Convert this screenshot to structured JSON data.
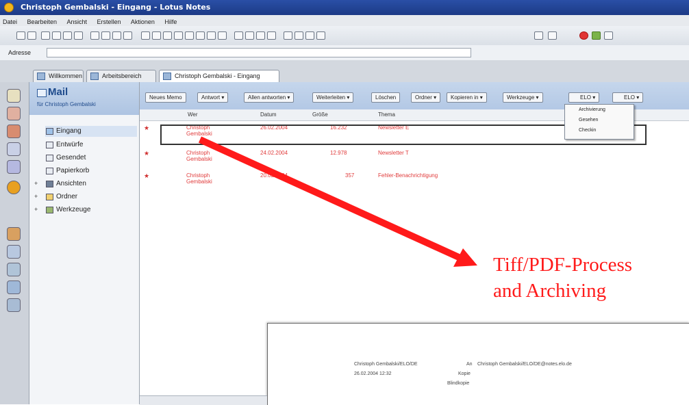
{
  "window": {
    "title": "Christoph Gembalski - Eingang - Lotus Notes"
  },
  "menu": [
    "Datei",
    "Bearbeiten",
    "Ansicht",
    "Erstellen",
    "Aktionen",
    "Hilfe"
  ],
  "address": {
    "label": "Adresse"
  },
  "tabs": [
    {
      "label": "Willkommen"
    },
    {
      "label": "Arbeitsbereich"
    },
    {
      "label": "Christoph Gembalski - Eingang"
    }
  ],
  "nav": {
    "title": "Mail",
    "subtitle": "für Christoph Gembalski",
    "items": [
      {
        "label": "Eingang"
      },
      {
        "label": "Entwürfe"
      },
      {
        "label": "Gesendet"
      },
      {
        "label": "Papierkorb"
      },
      {
        "label": "Ansichten"
      },
      {
        "label": "Ordner"
      },
      {
        "label": "Werkzeuge"
      }
    ]
  },
  "actions": [
    "Neues Memo",
    "Antwort ▾",
    "Allen antworten ▾",
    "Weiterleiten ▾",
    "Löschen",
    "Ordner ▾",
    "Kopieren in ▾",
    "Werkzeuge ▾",
    "ELO ▾",
    "ELO ▾"
  ],
  "dropdown": {
    "items": [
      "Archivierung",
      "Gesehen",
      "Checkin"
    ]
  },
  "columns": {
    "from": "Wer",
    "date": "Datum",
    "size": "Größe",
    "subject": "Thema"
  },
  "rows": [
    {
      "from": "Christoph Gembalski",
      "date": "26.02.2004",
      "size": "16.232",
      "subject": "Newsletter E"
    },
    {
      "from": "Christoph Gembalski",
      "date": "24.02.2004",
      "size": "12.978",
      "subject": "Newsletter T"
    },
    {
      "from": "Christoph Gembalski",
      "date": "20.02.2004",
      "size": "357",
      "subject": "Fehler-Benachrichtigung"
    }
  ],
  "annotation": {
    "line1": "Tiff/PDF-Process",
    "line2": "and Archiving"
  },
  "preview": {
    "sender": "Christoph Gembalski/ELO/DE",
    "datetime": "26.02.2004 12:32",
    "to_label": "An",
    "to_value": "Christoph Gembalski/ELO/DE@notes.elo.de",
    "cc_label": "Kopie",
    "bcc_label": "Blindkopie"
  },
  "colors": {
    "accent": "#1f4b8c",
    "unread": "#e03a3a",
    "annotation": "#ff1a1a"
  }
}
